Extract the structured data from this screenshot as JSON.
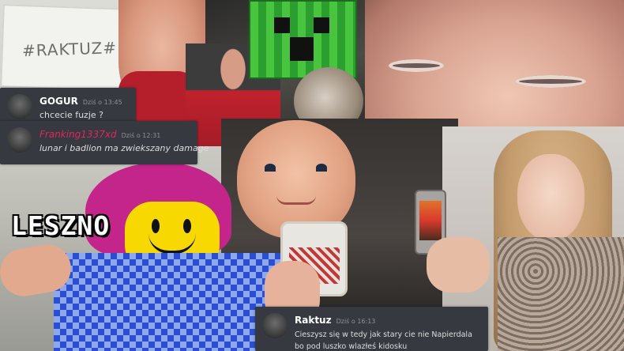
{
  "collage": {
    "sign_text": "#RAKTUZ#",
    "overlay_title": "LESZNO"
  },
  "messages": [
    {
      "user": "GOGUR",
      "time": "Dziś o 13:45",
      "text": "chcecie fuzje ?"
    },
    {
      "user": "Franking1337xd",
      "time": "Dziś o 12:31",
      "text": "lunar i badlion ma zwiekszany damage"
    },
    {
      "user": "Raktuz",
      "time": "Dziś o 16:13",
      "text": "Cieszysz się w tedy jak stary cie nie Napierdala bo pod luszko wlazłeś kidosku"
    }
  ],
  "colors": {
    "chat_bg": "#36393f",
    "username_highlight": "#e1285a",
    "roblox_hair": "#c3258b",
    "roblox_shirt": "#2b4fd3",
    "creeper": "#49c43e"
  }
}
